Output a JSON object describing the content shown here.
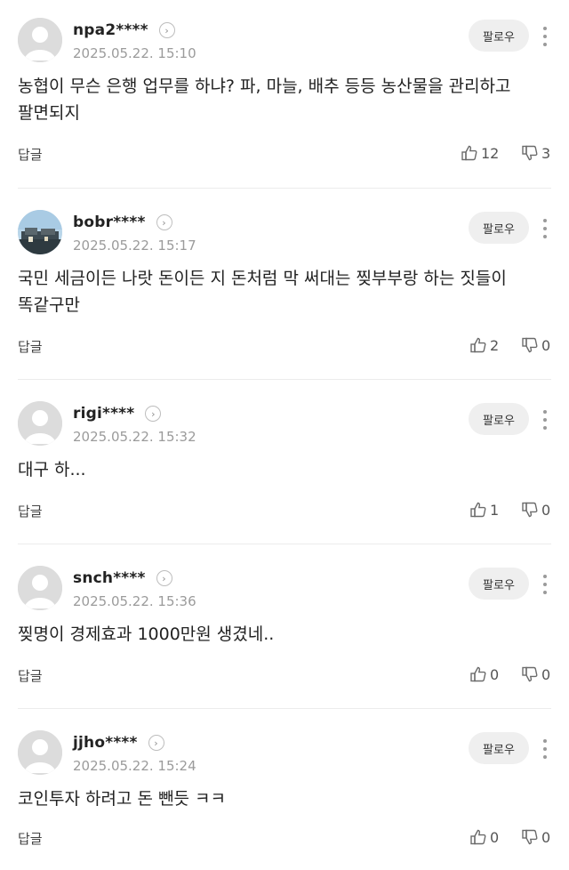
{
  "follow_label": "팔로우",
  "reply_label": "답글",
  "comments": [
    {
      "nickname": "npa2****",
      "date": "2025.05.22. 15:10",
      "text": "농협이 무슨 은행 업무를 하냐? 파, 마늘, 배추 등등 농산물을 관리하고 팔면되지",
      "likes": "12",
      "dislikes": "3",
      "avatar": "default-profile"
    },
    {
      "nickname": "bobr****",
      "date": "2025.05.22. 15:17",
      "text": "국민 세금이든 나랏 돈이든 지 돈처럼 막 써대는 찢부부랑 하는 짓들이 똑같구만",
      "likes": "2",
      "dislikes": "0",
      "avatar": "photo-profile"
    },
    {
      "nickname": "rigi****",
      "date": "2025.05.22. 15:32",
      "text": "대구 하...",
      "likes": "1",
      "dislikes": "0",
      "avatar": "default-profile"
    },
    {
      "nickname": "snch****",
      "date": "2025.05.22. 15:36",
      "text": "찢명이 경제효과 1000만원 생겼네..",
      "likes": "0",
      "dislikes": "0",
      "avatar": "default-profile"
    },
    {
      "nickname": "jjho****",
      "date": "2025.05.22. 15:24",
      "text": "코인투자 하려고 돈 뺀듯 ㅋㅋ",
      "likes": "0",
      "dislikes": "0",
      "avatar": "default-profile"
    }
  ]
}
